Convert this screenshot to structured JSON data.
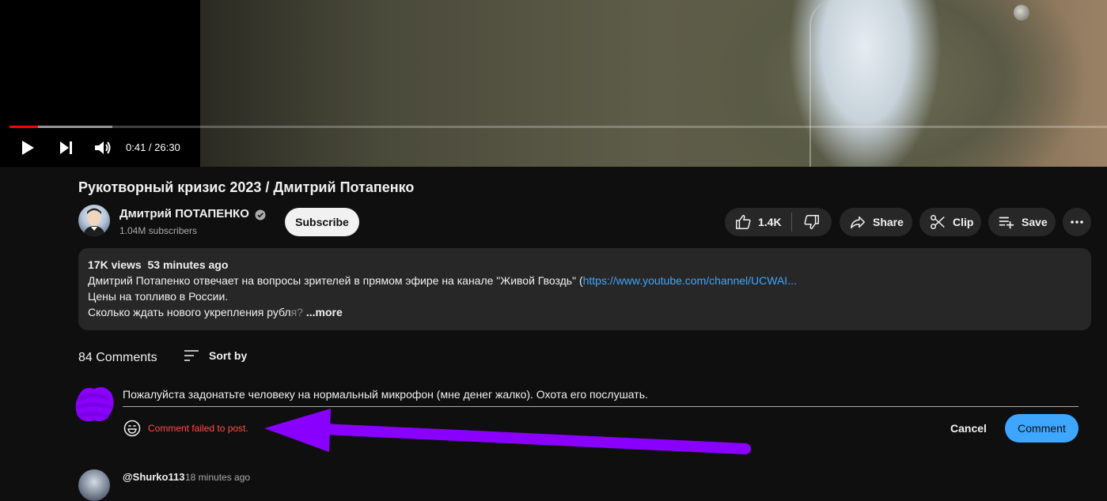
{
  "player": {
    "time_display": "0:41 / 26:30",
    "progress_played": 0.026,
    "progress_buffered": 0.094
  },
  "video": {
    "title": "Рукотворный кризис 2023 / Дмитрий Потапенко",
    "channel_name": "Дмитрий ПОТАПЕНКО",
    "subscribers": "1.04M subscribers",
    "subscribe_label": "Subscribe"
  },
  "actions": {
    "likes": "1.4K",
    "share_label": "Share",
    "clip_label": "Clip",
    "save_label": "Save"
  },
  "description": {
    "meta": "17K views  53 minutes ago",
    "line1_text": "Дмитрий Потапенко отвечает на вопросы зрителей в прямом эфире на канале \"Живой Гвоздь\" (",
    "line1_link": "https://www.youtube.com/channel/UCWAI...",
    "line2": "Цены на топливо в России.",
    "line3_text": "Сколько ждать нового укрепления рубл",
    "line3_fade": "я?",
    "more_label": " ...more"
  },
  "comments": {
    "count_label": "84 Comments",
    "sort_label": "Sort by",
    "draft_text": "Пожалуйста задонатьте человеку на нормальный микрофон (мне денег жалко). Охота его послушать.",
    "error_text": "Comment failed to post.",
    "cancel_label": "Cancel",
    "submit_label": "Comment",
    "next_author": "@Shurko113",
    "next_time": "18 minutes ago"
  },
  "colors": {
    "accent": "#3ea6ff",
    "error": "#ff4e45",
    "annotation": "#8a00ff",
    "progress": "#ff0000"
  }
}
